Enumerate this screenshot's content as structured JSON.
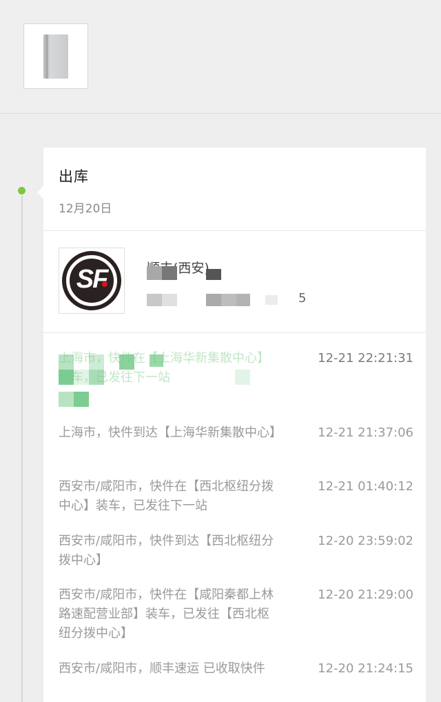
{
  "status": {
    "title": "出库",
    "date": "12月20日"
  },
  "courier": {
    "name": "顺丰(西安)",
    "phone": "5"
  },
  "colors": {
    "accent_green": "#7cc83f",
    "latest_event_green": "#4cb862"
  },
  "events": [
    {
      "text": "上海市，快件在【上海华新集散中心】装车，已发往下一站",
      "time": "12-21 22:21:31"
    },
    {
      "text": "上海市，快件到达【上海华新集散中心】",
      "time": "12-21 21:37:06"
    },
    {
      "text": "西安市/咸阳市，快件在【西北枢纽分拨中心】装车，已发往下一站",
      "time": "12-21 01:40:12"
    },
    {
      "text": "西安市/咸阳市，快件到达【西北枢纽分拨中心】",
      "time": "12-20 23:59:02"
    },
    {
      "text": "西安市/咸阳市，快件在【咸阳秦都上林路速配营业部】装车，已发往【西北枢纽分拨中心】",
      "time": "12-20 21:29:00"
    },
    {
      "text": "西安市/咸阳市，顺丰速运 已收取快件",
      "time": "12-20 21:24:15"
    }
  ]
}
